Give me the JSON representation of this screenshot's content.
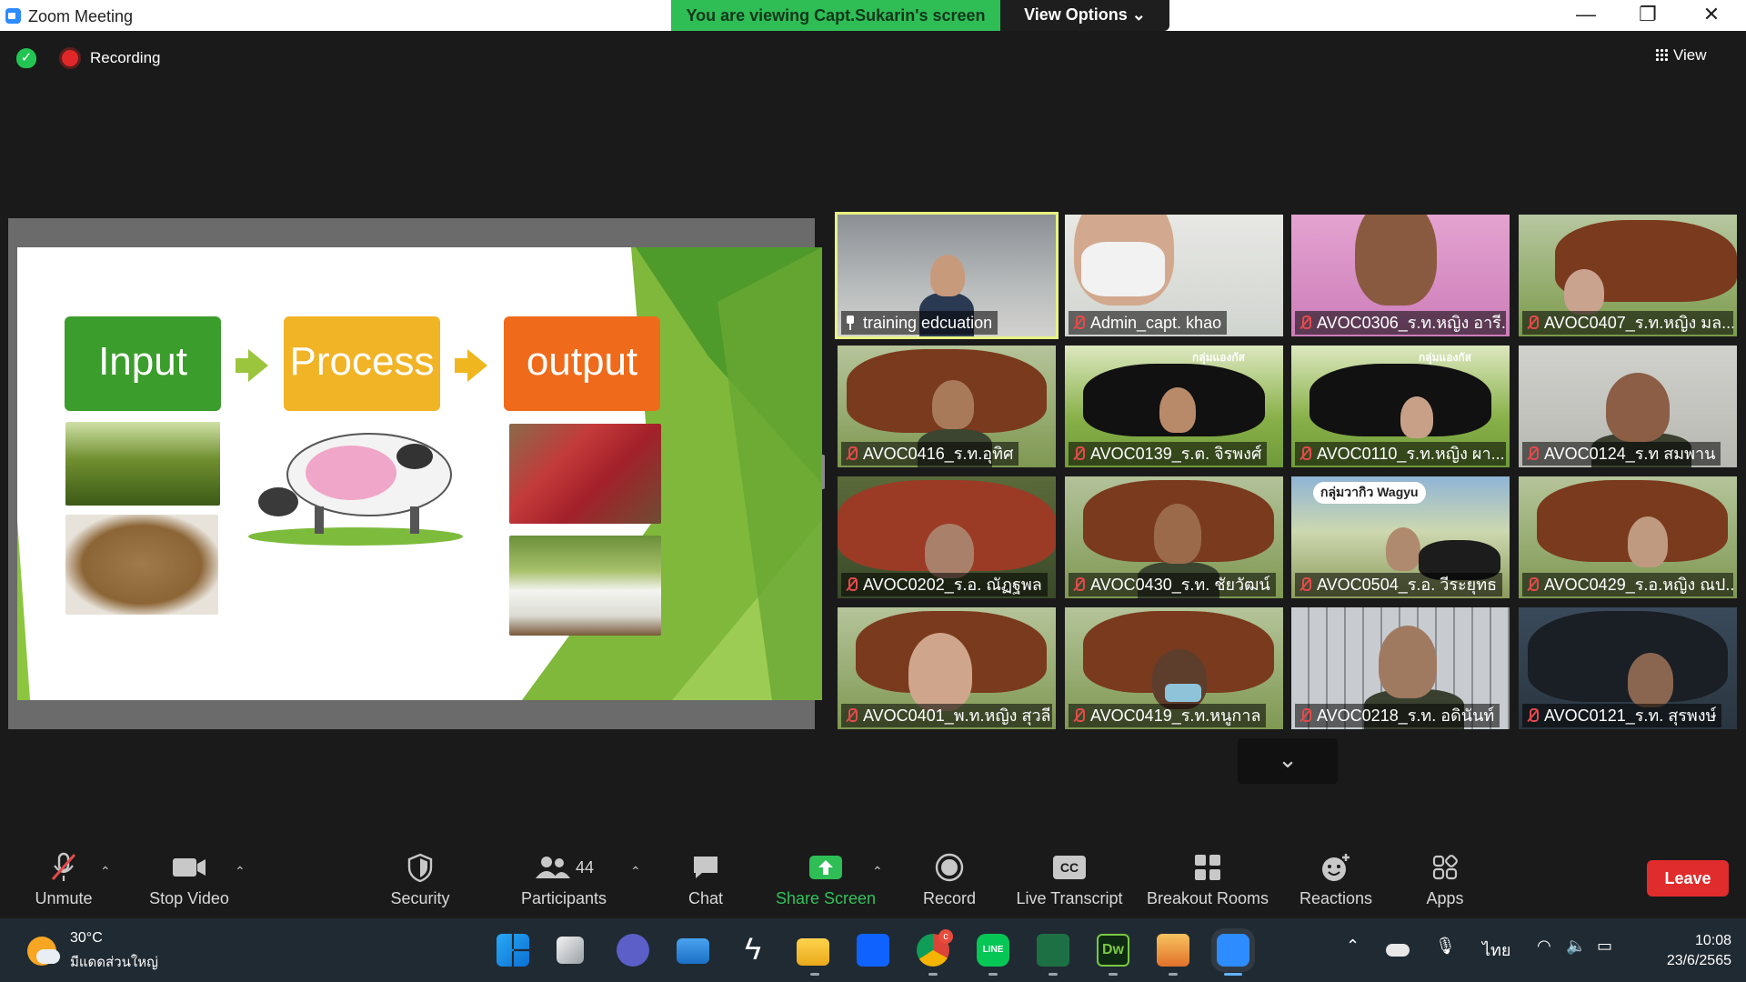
{
  "window": {
    "title": "Zoom Meeting",
    "controls": {
      "minimize": "—",
      "restore": "❐",
      "close": "✕"
    }
  },
  "banner": {
    "text": "You are viewing Capt.Sukarin's screen",
    "view_options": "View Options ⌄"
  },
  "meeting": {
    "recording_label": "Recording",
    "view_label": "View"
  },
  "slide": {
    "steps": [
      {
        "label": "Input",
        "color": "#3b9d2b"
      },
      {
        "label": "Process",
        "color": "#f1b426"
      },
      {
        "label": "output",
        "color": "#ef6b1b"
      }
    ]
  },
  "participants": [
    {
      "name": "training edcuation",
      "pinned": true,
      "active": true
    },
    {
      "name": "Admin_capt. khao",
      "muted": true
    },
    {
      "name": "AVOC0306_ร.ท.หญิง อารี...",
      "muted": true
    },
    {
      "name": "AVOC0407_ร.ท.หญิง มล...",
      "muted": true
    },
    {
      "name": "AVOC0416_ร.ท.อุทิศ",
      "muted": true
    },
    {
      "name": "AVOC0139_ร.ต. จิรพงศ์",
      "muted": true
    },
    {
      "name": "AVOC0110_ร.ท.หญิง ผา...",
      "muted": true
    },
    {
      "name": "AVOC0124_ร.ท สมพาน",
      "muted": true
    },
    {
      "name": "AVOC0202_ร.อ. ณัฏฐพล",
      "muted": true
    },
    {
      "name": "AVOC0430_ร.ท. ชัยวัฒน์",
      "muted": true
    },
    {
      "name": "AVOC0504_ร.อ. วีระยุทธ",
      "muted": true
    },
    {
      "name": "AVOC0429_ร.อ.หญิง ณป...",
      "muted": true
    },
    {
      "name": "AVOC0401_พ.ท.หญิง สุวลี",
      "muted": true
    },
    {
      "name": "AVOC0419_ร.ท.หนูกาล",
      "muted": true
    },
    {
      "name": "AVOC0218_ร.ท. อดินันท์",
      "muted": true
    },
    {
      "name": "AVOC0121_ร.ท. สุรพงษ์",
      "muted": true
    }
  ],
  "tile_texts": {
    "ranch_sign": "กลุ่มแองกัส",
    "wagyu_sign": "กลุ่มวากิว Wagyu"
  },
  "toolbar": {
    "unmute": "Unmute",
    "stop_video": "Stop Video",
    "security": "Security",
    "participants": "Participants",
    "participants_count": "44",
    "chat": "Chat",
    "share_screen": "Share Screen",
    "record": "Record",
    "live_transcript": "Live Transcript",
    "cc_badge": "CC",
    "breakout_rooms": "Breakout Rooms",
    "reactions": "Reactions",
    "apps": "Apps",
    "leave": "Leave"
  },
  "taskbar": {
    "temperature": "30°C",
    "condition": "มีแดดส่วนใหญ่",
    "language": "ไทย",
    "time": "10:08",
    "date": "23/6/2565",
    "chrome_badge": "c",
    "line_label": "LINE",
    "dw_label": "Dw"
  },
  "colors": {
    "share_green": "#2fbd55",
    "leave_red": "#e02c2c",
    "active_speaker": "#e8f283"
  }
}
